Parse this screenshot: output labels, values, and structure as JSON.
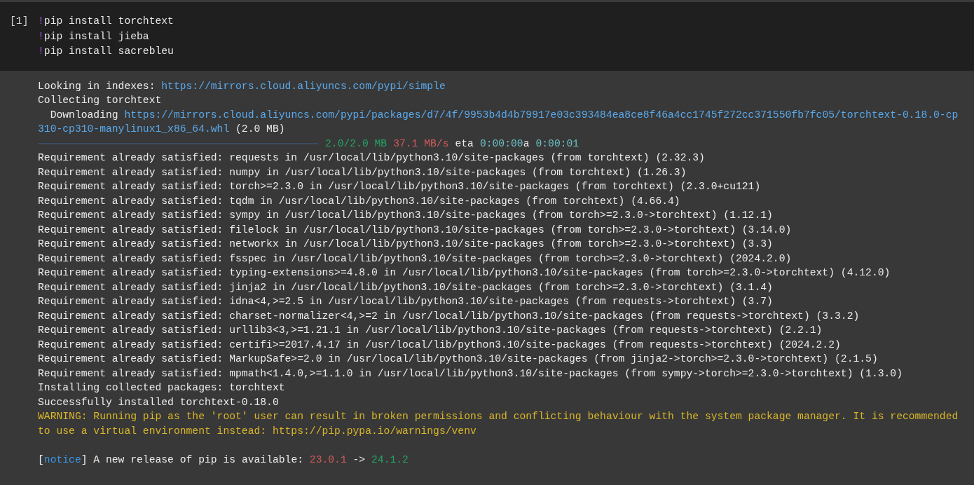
{
  "cell": {
    "prompt": "[1]",
    "code": [
      {
        "bang": "!",
        "command": "pip install torchtext"
      },
      {
        "bang": "!",
        "command": "pip install jieba"
      },
      {
        "bang": "!",
        "command": "pip install sacrebleu"
      }
    ]
  },
  "output": {
    "lines": [
      {
        "kind": "text",
        "segments": [
          {
            "kind": "plain",
            "text": "Looking in indexes: "
          },
          {
            "kind": "link",
            "text": "https://mirrors.cloud.aliyuncs.com/pypi/simple"
          }
        ]
      },
      {
        "kind": "text",
        "segments": [
          {
            "kind": "plain",
            "text": "Collecting torchtext"
          }
        ]
      },
      {
        "kind": "text",
        "segments": [
          {
            "kind": "plain",
            "text": "  Downloading "
          },
          {
            "kind": "link",
            "text": "https://mirrors.cloud.aliyuncs.com/pypi/packages/d7/4f/9953b4d4b79917e03c393484ea8ce8f46a4cc1745f272cc371550fb7fc05/torchtext-0.18.0-cp"
          }
        ]
      },
      {
        "kind": "text",
        "segments": [
          {
            "kind": "link",
            "text": "310-cp310-manylinux1_x86_64.whl"
          },
          {
            "kind": "plain",
            "text": " (2.0 MB)"
          }
        ]
      },
      {
        "kind": "progress",
        "level": 1,
        "segments": [
          {
            "kind": "green",
            "text": "2.0/2.0 MB"
          },
          {
            "kind": "red",
            "text": "37.1 MB/s"
          },
          {
            "kind": "plain",
            "text": "eta"
          },
          {
            "kind": "cyan",
            "text": "0:00:00"
          },
          {
            "kind": "plain",
            "text": "a"
          },
          {
            "kind": "cyan",
            "text": "0:00:01"
          }
        ]
      },
      {
        "kind": "text",
        "segments": [
          {
            "kind": "plain",
            "text": "Requirement already satisfied: requests in /usr/local/lib/python3.10/site-packages (from torchtext) (2.32.3)"
          }
        ]
      },
      {
        "kind": "text",
        "segments": [
          {
            "kind": "plain",
            "text": "Requirement already satisfied: numpy in /usr/local/lib/python3.10/site-packages (from torchtext) (1.26.3)"
          }
        ]
      },
      {
        "kind": "text",
        "segments": [
          {
            "kind": "plain",
            "text": "Requirement already satisfied: torch>=2.3.0 in /usr/local/lib/python3.10/site-packages (from torchtext) (2.3.0+cu121)"
          }
        ]
      },
      {
        "kind": "text",
        "segments": [
          {
            "kind": "plain",
            "text": "Requirement already satisfied: tqdm in /usr/local/lib/python3.10/site-packages (from torchtext) (4.66.4)"
          }
        ]
      },
      {
        "kind": "text",
        "segments": [
          {
            "kind": "plain",
            "text": "Requirement already satisfied: sympy in /usr/local/lib/python3.10/site-packages (from torch>=2.3.0->torchtext) (1.12.1)"
          }
        ]
      },
      {
        "kind": "text",
        "segments": [
          {
            "kind": "plain",
            "text": "Requirement already satisfied: filelock in /usr/local/lib/python3.10/site-packages (from torch>=2.3.0->torchtext) (3.14.0)"
          }
        ]
      },
      {
        "kind": "text",
        "segments": [
          {
            "kind": "plain",
            "text": "Requirement already satisfied: networkx in /usr/local/lib/python3.10/site-packages (from torch>=2.3.0->torchtext) (3.3)"
          }
        ]
      },
      {
        "kind": "text",
        "segments": [
          {
            "kind": "plain",
            "text": "Requirement already satisfied: fsspec in /usr/local/lib/python3.10/site-packages (from torch>=2.3.0->torchtext) (2024.2.0)"
          }
        ]
      },
      {
        "kind": "text",
        "segments": [
          {
            "kind": "plain",
            "text": "Requirement already satisfied: typing-extensions>=4.8.0 in /usr/local/lib/python3.10/site-packages (from torch>=2.3.0->torchtext) (4.12.0)"
          }
        ]
      },
      {
        "kind": "text",
        "segments": [
          {
            "kind": "plain",
            "text": "Requirement already satisfied: jinja2 in /usr/local/lib/python3.10/site-packages (from torch>=2.3.0->torchtext) (3.1.4)"
          }
        ]
      },
      {
        "kind": "text",
        "segments": [
          {
            "kind": "plain",
            "text": "Requirement already satisfied: idna<4,>=2.5 in /usr/local/lib/python3.10/site-packages (from requests->torchtext) (3.7)"
          }
        ]
      },
      {
        "kind": "text",
        "segments": [
          {
            "kind": "plain",
            "text": "Requirement already satisfied: charset-normalizer<4,>=2 in /usr/local/lib/python3.10/site-packages (from requests->torchtext) (3.3.2)"
          }
        ]
      },
      {
        "kind": "text",
        "segments": [
          {
            "kind": "plain",
            "text": "Requirement already satisfied: urllib3<3,>=1.21.1 in /usr/local/lib/python3.10/site-packages (from requests->torchtext) (2.2.1)"
          }
        ]
      },
      {
        "kind": "text",
        "segments": [
          {
            "kind": "plain",
            "text": "Requirement already satisfied: certifi>=2017.4.17 in /usr/local/lib/python3.10/site-packages (from requests->torchtext) (2024.2.2)"
          }
        ]
      },
      {
        "kind": "text",
        "segments": [
          {
            "kind": "plain",
            "text": "Requirement already satisfied: MarkupSafe>=2.0 in /usr/local/lib/python3.10/site-packages (from jinja2->torch>=2.3.0->torchtext) (2.1.5)"
          }
        ]
      },
      {
        "kind": "text",
        "segments": [
          {
            "kind": "plain",
            "text": "Requirement already satisfied: mpmath<1.4.0,>=1.1.0 in /usr/local/lib/python3.10/site-packages (from sympy->torch>=2.3.0->torchtext) (1.3.0)"
          }
        ]
      },
      {
        "kind": "text",
        "segments": [
          {
            "kind": "plain",
            "text": "Installing collected packages: torchtext"
          }
        ]
      },
      {
        "kind": "text",
        "segments": [
          {
            "kind": "plain",
            "text": "Successfully installed torchtext-0.18.0"
          }
        ]
      },
      {
        "kind": "text",
        "segments": [
          {
            "kind": "warning",
            "text": "WARNING: Running pip as the 'root' user can result in broken permissions and conflicting behaviour with the system package manager. It is recommended"
          }
        ]
      },
      {
        "kind": "text",
        "segments": [
          {
            "kind": "warning",
            "text": "to use a virtual environment instead: https://pip.pypa.io/warnings/venv"
          }
        ]
      },
      {
        "kind": "text",
        "spaced": true,
        "segments": [
          {
            "kind": "plain",
            "text": "["
          },
          {
            "kind": "notice",
            "text": "notice"
          },
          {
            "kind": "plain",
            "text": "] A new release of pip is available: "
          },
          {
            "kind": "red",
            "text": "23.0.1"
          },
          {
            "kind": "plain",
            "text": " -> "
          },
          {
            "kind": "green",
            "text": "24.1.2"
          }
        ]
      }
    ]
  }
}
